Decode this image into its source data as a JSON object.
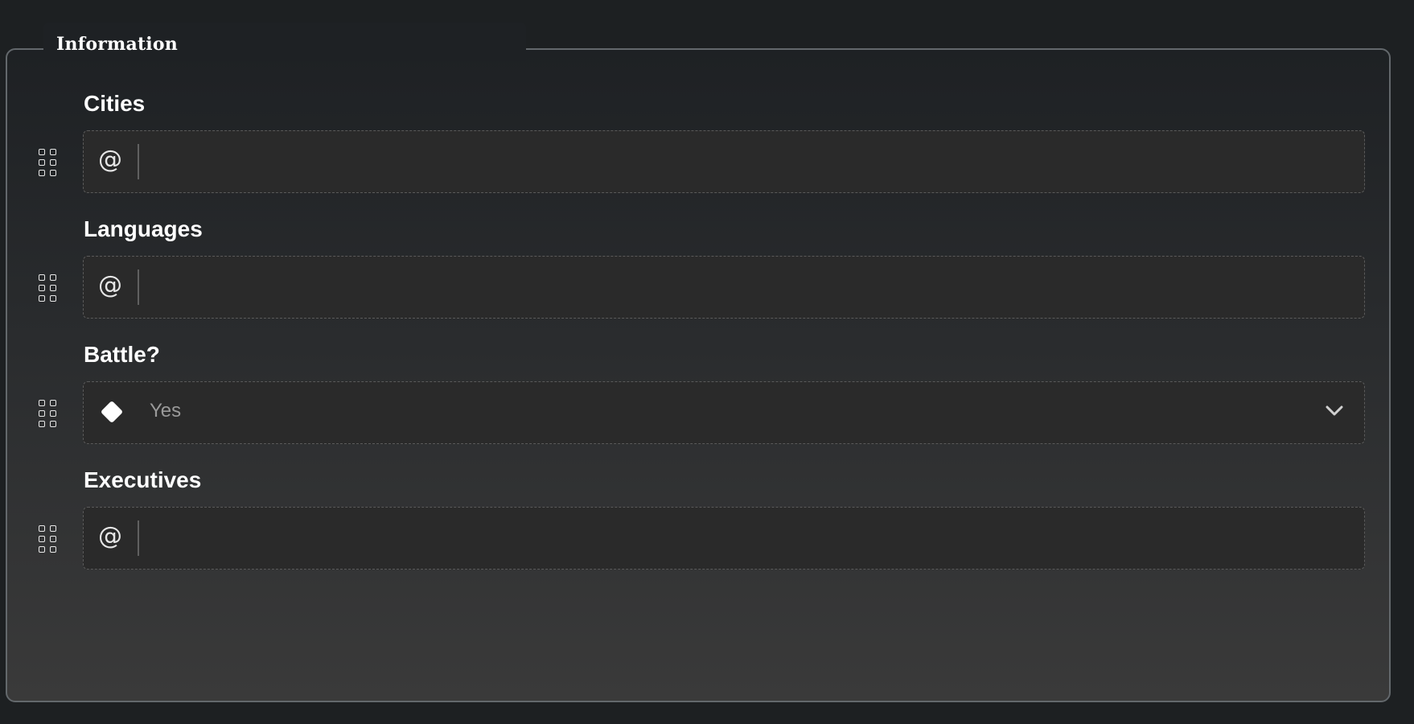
{
  "section": {
    "title": "Information"
  },
  "fields": [
    {
      "label": "Cities",
      "type": "text",
      "icon": "at-icon",
      "prefix_symbol": "@",
      "value": ""
    },
    {
      "label": "Languages",
      "type": "text",
      "icon": "at-icon",
      "prefix_symbol": "@",
      "value": ""
    },
    {
      "label": "Battle?",
      "type": "select",
      "icon": "diamond-icon",
      "value": "Yes"
    },
    {
      "label": "Executives",
      "type": "text",
      "icon": "at-icon",
      "prefix_symbol": "@",
      "value": ""
    }
  ],
  "colors": {
    "background": "#1d2022",
    "panel_border": "#63686c",
    "field_background": "#2a2a2a",
    "label_text": "#ffffff",
    "placeholder_text": "#9a9a9a"
  }
}
